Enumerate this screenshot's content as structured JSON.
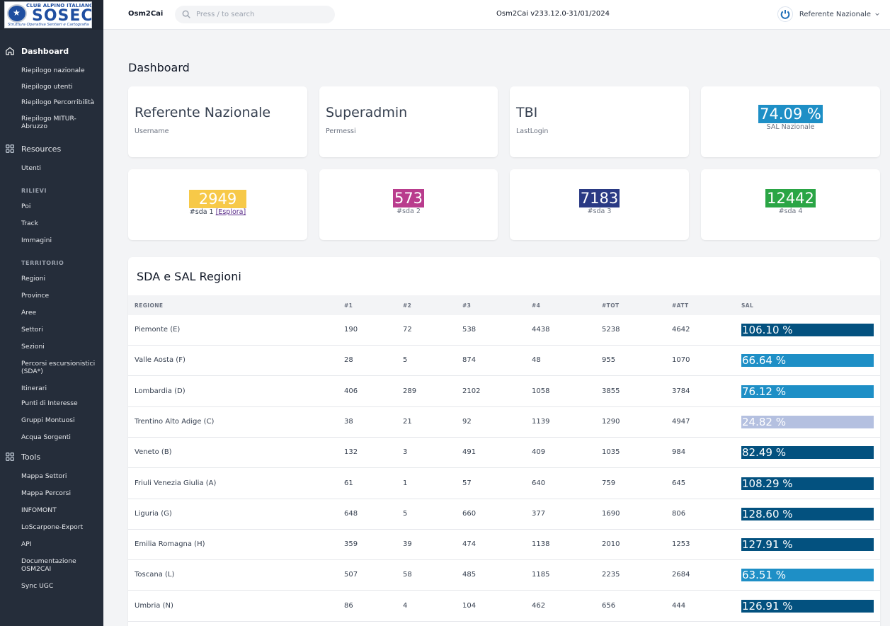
{
  "sidebar": {
    "logo": {
      "top_text": "CLUB ALPINO ITALIANO",
      "main": "SOSEC",
      "sub": "Struttura Operativa Sentieri e Cartografia"
    },
    "dashboard": {
      "label": "Dashboard",
      "items": [
        "Riepilogo nazionale",
        "Riepilogo utenti",
        "Riepilogo Percorribilità",
        "Riepilogo MITUR-Abruzzo"
      ]
    },
    "resources": {
      "label": "Resources",
      "items": [
        "Utenti"
      ],
      "rilievi_head": "RILIEVI",
      "rilievi": [
        "Poi",
        "Track",
        "Immagini"
      ],
      "territorio_head": "TERRITORIO",
      "territorio": [
        "Regioni",
        "Province",
        "Aree",
        "Settori",
        "Sezioni",
        "Percorsi escursionistici (SDA*)",
        "Itinerari",
        "Punti di Interesse",
        "Gruppi Montuosi",
        "Acqua Sorgenti"
      ]
    },
    "tools": {
      "label": "Tools",
      "items": [
        "Mappa Settori",
        "Mappa Percorsi",
        "INFOMONT",
        "LoScarpone-Export",
        "API",
        "Documentazione OSM2CAI",
        "Sync UGC"
      ]
    }
  },
  "topbar": {
    "brand": "Osm2Cai",
    "search_placeholder": "Press / to search",
    "version": "Osm2Cai v233.12.0-31/01/2024",
    "user": "Referente Nazionale"
  },
  "page_title": "Dashboard",
  "cards": {
    "username": {
      "value": "Referente Nazionale",
      "label": "Username"
    },
    "permessi": {
      "value": "Superadmin",
      "label": "Permessi"
    },
    "lastlogin": {
      "value": "TBI",
      "label": "LastLogin"
    },
    "sal": {
      "value": "74.09 %",
      "label": "SAL Nazionale",
      "color": "#1e8fc6"
    }
  },
  "sda": [
    {
      "value": "2949",
      "label": "#sda 1",
      "link": "[Esplora]",
      "color": "#f7c948"
    },
    {
      "value": "573",
      "label": "#sda 2",
      "color": "#b93c8d"
    },
    {
      "value": "7183",
      "label": "#sda 3",
      "color": "#2a3a84"
    },
    {
      "value": "12442",
      "label": "#sda 4",
      "color": "#2aa545"
    }
  ],
  "table": {
    "title": "SDA e SAL Regioni",
    "headers": [
      "REGIONE",
      "#1",
      "#2",
      "#3",
      "#4",
      "#TOT",
      "#ATT",
      "SAL"
    ],
    "rows": [
      {
        "regione": "Piemonte (E)",
        "c1": "190",
        "c2": "72",
        "c3": "538",
        "c4": "4438",
        "tot": "5238",
        "att": "4642",
        "sal": "106.10 %",
        "color": "#03517f"
      },
      {
        "regione": "Valle Aosta (F)",
        "c1": "28",
        "c2": "5",
        "c3": "874",
        "c4": "48",
        "tot": "955",
        "att": "1070",
        "sal": "66.64 %",
        "color": "#1e8fc6"
      },
      {
        "regione": "Lombardia (D)",
        "c1": "406",
        "c2": "289",
        "c3": "2102",
        "c4": "1058",
        "tot": "3855",
        "att": "3784",
        "sal": "76.12 %",
        "color": "#1e8fc6"
      },
      {
        "regione": "Trentino Alto Adige (C)",
        "c1": "38",
        "c2": "21",
        "c3": "92",
        "c4": "1139",
        "tot": "1290",
        "att": "4947",
        "sal": "24.82 %",
        "color": "#b4c0e0"
      },
      {
        "regione": "Veneto (B)",
        "c1": "132",
        "c2": "3",
        "c3": "491",
        "c4": "409",
        "tot": "1035",
        "att": "984",
        "sal": "82.49 %",
        "color": "#03517f"
      },
      {
        "regione": "Friuli Venezia Giulia (A)",
        "c1": "61",
        "c2": "1",
        "c3": "57",
        "c4": "640",
        "tot": "759",
        "att": "645",
        "sal": "108.29 %",
        "color": "#03517f"
      },
      {
        "regione": "Liguria (G)",
        "c1": "648",
        "c2": "5",
        "c3": "660",
        "c4": "377",
        "tot": "1690",
        "att": "806",
        "sal": "128.60 %",
        "color": "#03517f"
      },
      {
        "regione": "Emilia Romagna (H)",
        "c1": "359",
        "c2": "39",
        "c3": "474",
        "c4": "1138",
        "tot": "2010",
        "att": "1253",
        "sal": "127.91 %",
        "color": "#03517f"
      },
      {
        "regione": "Toscana (L)",
        "c1": "507",
        "c2": "58",
        "c3": "485",
        "c4": "1185",
        "tot": "2235",
        "att": "2684",
        "sal": "63.51 %",
        "color": "#1e8fc6"
      },
      {
        "regione": "Umbria (N)",
        "c1": "86",
        "c2": "4",
        "c3": "104",
        "c4": "462",
        "tot": "656",
        "att": "444",
        "sal": "126.91 %",
        "color": "#03517f"
      }
    ]
  }
}
